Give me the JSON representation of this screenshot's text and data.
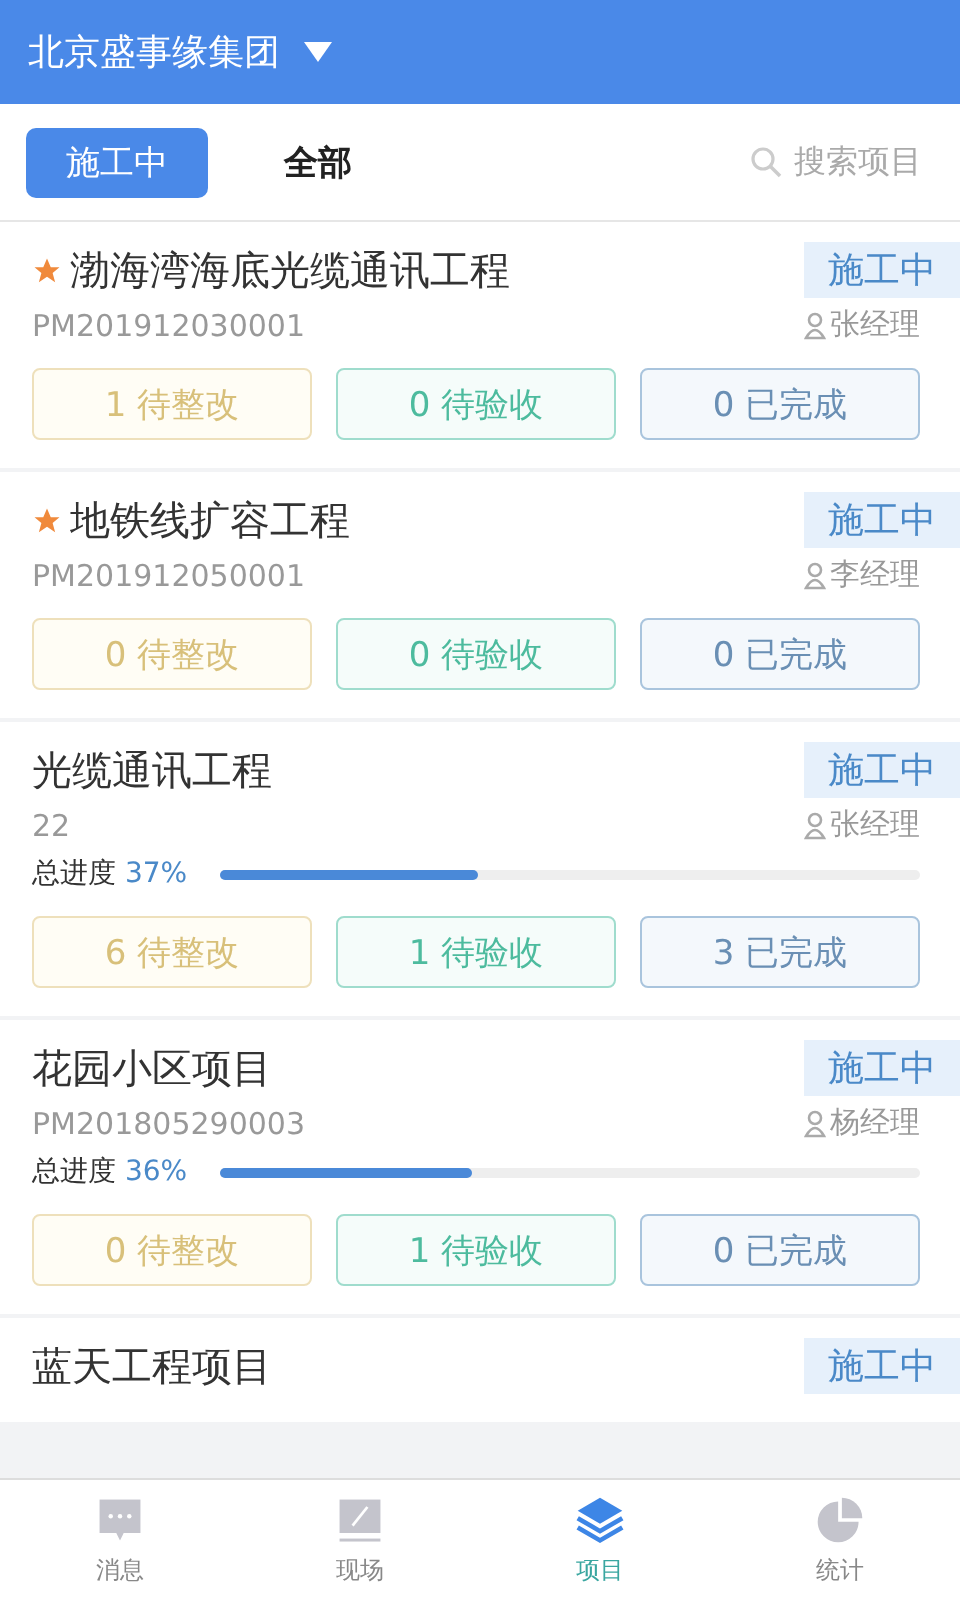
{
  "header": {
    "title": "北京盛事缘集团"
  },
  "tabs": [
    {
      "label": "施工中",
      "selected": true
    },
    {
      "label": "全部",
      "selected": false
    }
  ],
  "search": {
    "placeholder": "搜索项目"
  },
  "projects": [
    {
      "name": "渤海湾海底光缆通讯工程",
      "starred": true,
      "code": "PM201912030001",
      "status": "施工中",
      "manager": "张经理",
      "counts": [
        {
          "kind": "rectify",
          "text": "1 待整改"
        },
        {
          "kind": "accept",
          "text": "0 待验收"
        },
        {
          "kind": "done",
          "text": "0 已完成"
        }
      ]
    },
    {
      "name": "地铁线扩容工程",
      "starred": true,
      "code": "PM201912050001",
      "status": "施工中",
      "manager": "李经理",
      "counts": [
        {
          "kind": "rectify",
          "text": "0 待整改"
        },
        {
          "kind": "accept",
          "text": "0 待验收"
        },
        {
          "kind": "done",
          "text": "0 已完成"
        }
      ]
    },
    {
      "name": "光缆通讯工程",
      "starred": false,
      "code": "22",
      "status": "施工中",
      "manager": "张经理",
      "progress_label": "总进度",
      "progress_value": "37%",
      "level": 0.37,
      "counts": [
        {
          "kind": "rectify",
          "text": "6 待整改"
        },
        {
          "kind": "accept",
          "text": "1 待验收"
        },
        {
          "kind": "done",
          "text": "3 已完成"
        }
      ]
    },
    {
      "name": "花园小区项目",
      "starred": false,
      "code": "PM201805290003",
      "status": "施工中",
      "manager": "杨经理",
      "progress_label": "总进度",
      "progress_value": "36%",
      "level": 0.36,
      "counts": [
        {
          "kind": "rectify",
          "text": "0 待整改"
        },
        {
          "kind": "accept",
          "text": "1 待验收"
        },
        {
          "kind": "done",
          "text": "0 已完成"
        }
      ]
    },
    {
      "name": "蓝天工程项目",
      "starred": false,
      "status": "施工中"
    }
  ],
  "nav": [
    {
      "kind": "message",
      "label": "消息",
      "selected": false
    },
    {
      "kind": "site",
      "label": "现场",
      "selected": false
    },
    {
      "kind": "project",
      "label": "项目",
      "selected": true
    },
    {
      "kind": "stats",
      "label": "统计",
      "selected": false
    }
  ]
}
